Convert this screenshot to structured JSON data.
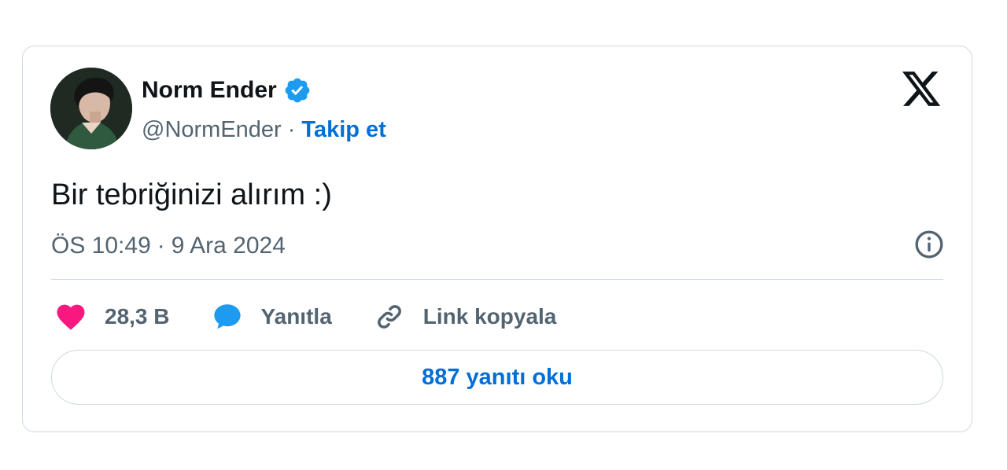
{
  "author": {
    "name": "Norm Ender",
    "handle": "@NormEnder",
    "separator": "·",
    "follow_label": "Takip et"
  },
  "tweet": {
    "text": "Bir tebriğinizi alırım :)",
    "time": "ÖS 10:49",
    "date_separator": "·",
    "date": "9 Ara 2024"
  },
  "actions": {
    "like_count": "28,3 B",
    "reply_label": "Yanıtla",
    "copy_link_label": "Link kopyala"
  },
  "read_replies_label": "887 yanıtı oku",
  "colors": {
    "accent": "#006fd6",
    "verified": "#1d9bf0",
    "heart": "#f91880",
    "text_primary": "#0f1419",
    "text_secondary": "#536471",
    "border": "#cfd9de"
  },
  "icons": [
    "avatar-image",
    "verified-badge-icon",
    "x-logo-icon",
    "info-icon",
    "heart-icon",
    "reply-bubble-icon",
    "link-icon"
  ]
}
